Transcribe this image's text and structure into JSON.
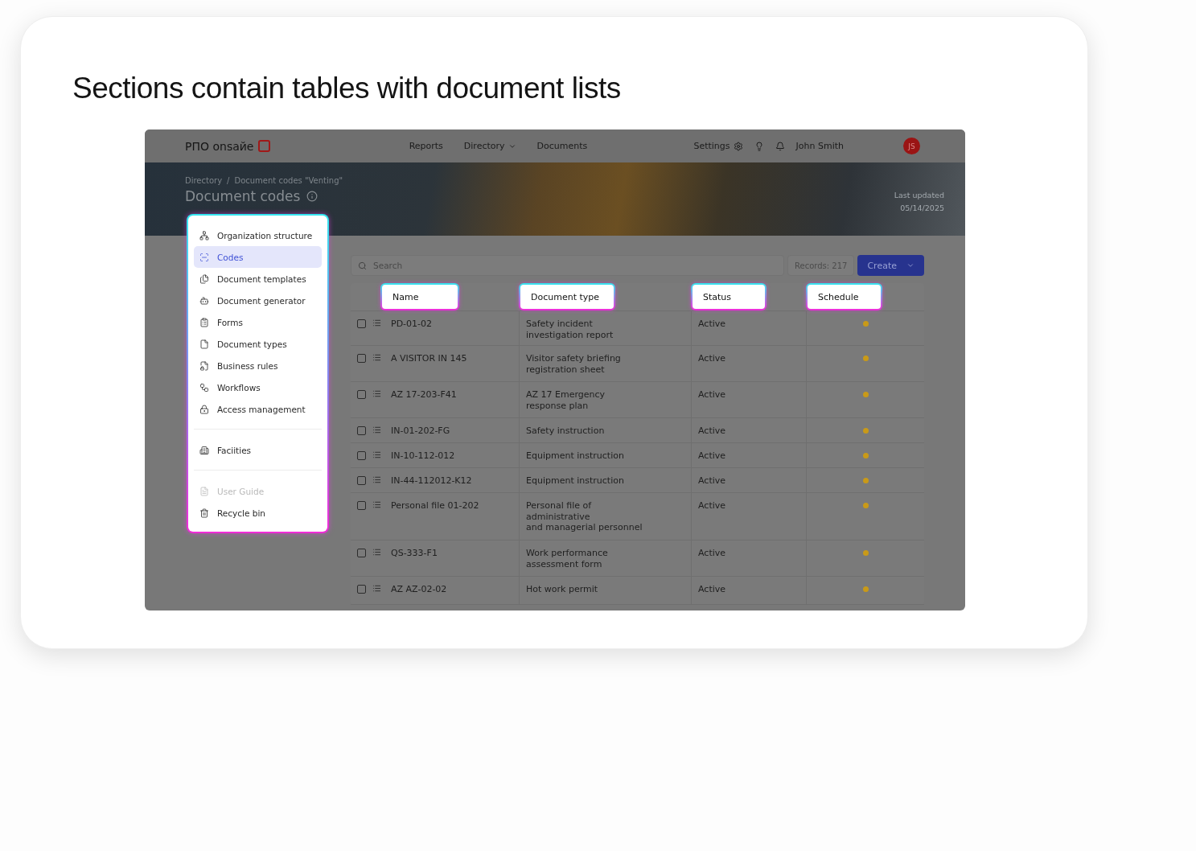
{
  "heading": "Sections contain tables with document lists",
  "app": {
    "logo": "РПО onsaйe",
    "nav": [
      {
        "label": "Reports",
        "dropdown": false
      },
      {
        "label": "Directory",
        "dropdown": true
      },
      {
        "label": "Documents",
        "dropdown": false
      }
    ],
    "settings": "Settings",
    "user": "John Smith",
    "avatar": "JS",
    "breadcrumbs": [
      "Directory",
      "Document codes \"Venting\""
    ],
    "breadcrumb_separator": "/",
    "page_title": "Document codes",
    "last_updated": {
      "label": "Last updated",
      "date": "05/14/2025"
    },
    "sidebar": {
      "groups": [
        [
          {
            "label": "Organization structure",
            "selected": false,
            "disabled": false
          },
          {
            "label": "Codes",
            "selected": true,
            "disabled": false
          },
          {
            "label": "Document templates",
            "selected": false,
            "disabled": false
          },
          {
            "label": "Document generator",
            "selected": false,
            "disabled": false
          },
          {
            "label": "Forms",
            "selected": false,
            "disabled": false
          },
          {
            "label": "Document types",
            "selected": false,
            "disabled": false
          },
          {
            "label": "Business rules",
            "selected": false,
            "disabled": false
          },
          {
            "label": "Workflows",
            "selected": false,
            "disabled": false
          },
          {
            "label": "Access management",
            "selected": false,
            "disabled": false
          }
        ],
        [
          {
            "label": "Faciities",
            "selected": false,
            "disabled": false
          }
        ],
        [
          {
            "label": "User Guide",
            "selected": false,
            "disabled": true
          },
          {
            "label": "Recycle bin",
            "selected": false,
            "disabled": false
          }
        ]
      ]
    },
    "search": {
      "placeholder": "Search"
    },
    "records": "Records: 217",
    "create_button": "Create",
    "table": {
      "columns": [
        "Name",
        "Document type",
        "Status",
        "Schedule"
      ],
      "rows": [
        {
          "checked": false,
          "name": "PD-01-02",
          "document_type": "Safety incident\ninvestigation report",
          "status": "Active",
          "color": "#c99a18"
        },
        {
          "checked": false,
          "name": "A VISITOR IN 145",
          "document_type": "Visitor safety briefing\nregistration sheet",
          "status": "Active",
          "color": "#c99a18"
        },
        {
          "checked": false,
          "name": "AZ 17-203-F41",
          "document_type": "AZ 17 Emergency\nresponse plan",
          "status": "Active",
          "color": "#c99a18"
        },
        {
          "checked": false,
          "name": "IN-01-202-FG",
          "document_type": "Safety instruction",
          "status": "Active",
          "color": "#c99a18"
        },
        {
          "checked": false,
          "name": "IN-10-112-012",
          "document_type": "Equipment instruction",
          "status": "Active",
          "color": "#c99a18"
        },
        {
          "checked": false,
          "name": "IN-44-112012-K12",
          "document_type": "Equipment instruction",
          "status": "Active",
          "color": "#c99a18"
        },
        {
          "checked": false,
          "name": "Personal file 01-202",
          "document_type": "Personal file of\nadministrative\nand managerial personnel",
          "status": "Active",
          "color": "#c99a18"
        },
        {
          "checked": false,
          "name": "QS-333-F1",
          "document_type": "Work performance\nassessment form",
          "status": "Active",
          "color": "#c99a18"
        },
        {
          "checked": false,
          "name": "AZ AZ-02-02",
          "document_type": "Hot work permit",
          "status": "Active",
          "color": "#c99a18"
        }
      ]
    }
  }
}
